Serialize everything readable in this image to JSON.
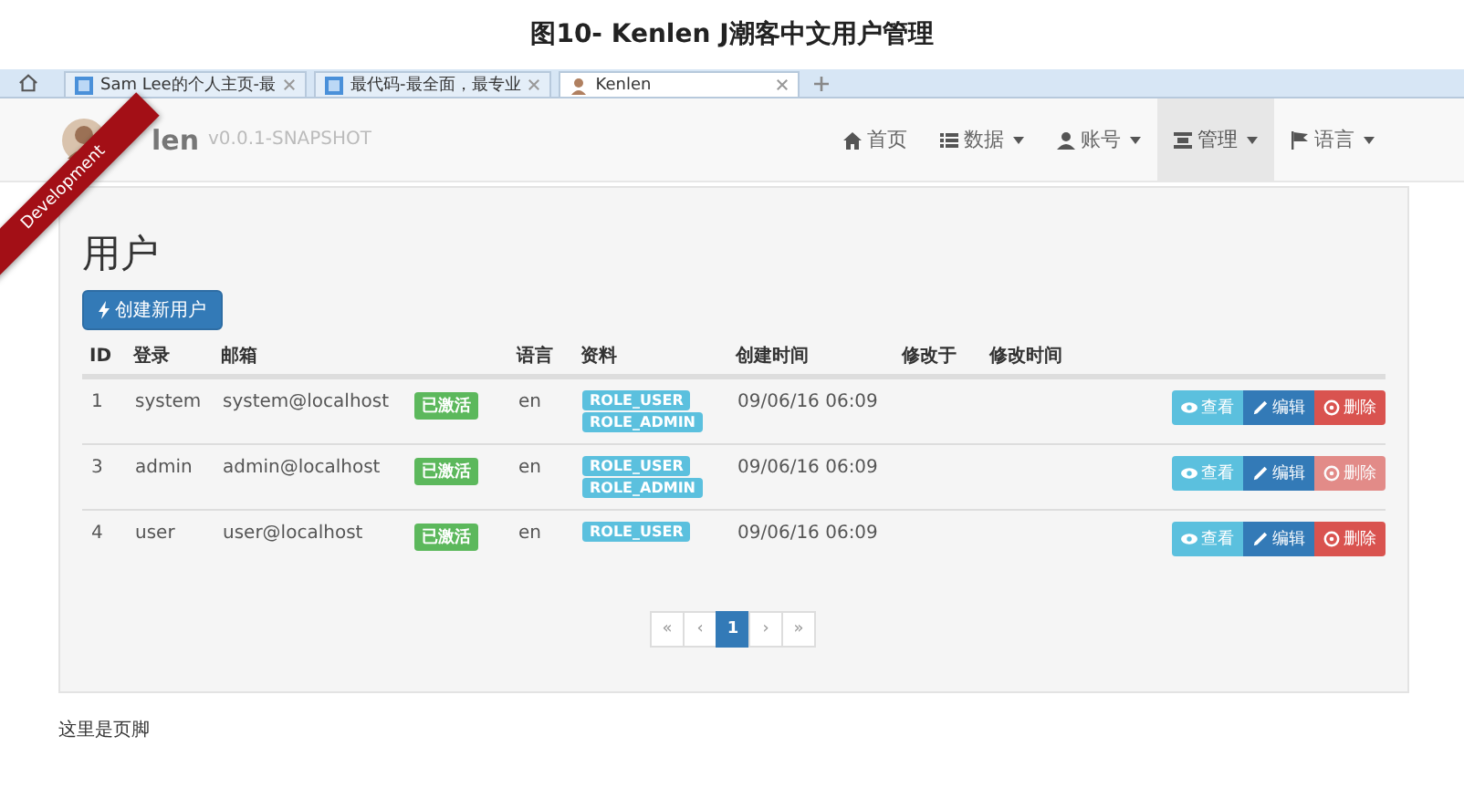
{
  "caption": "图10- Kenlen J潮客中文用户管理",
  "browser_tabs": [
    {
      "label": "Sam Lee的个人主页-最",
      "selected": false
    },
    {
      "label": "最代码-最全面，最专业",
      "selected": false
    },
    {
      "label": "Kenlen",
      "selected": true
    }
  ],
  "navbar": {
    "brand": "len",
    "version": "v0.0.1-SNAPSHOT",
    "ribbon": "Development",
    "items": [
      {
        "label": "首页",
        "dropdown": false,
        "selected": false
      },
      {
        "label": "数据",
        "dropdown": true,
        "selected": false
      },
      {
        "label": "账号",
        "dropdown": true,
        "selected": false
      },
      {
        "label": "管理",
        "dropdown": true,
        "selected": true
      },
      {
        "label": "语言",
        "dropdown": true,
        "selected": false
      }
    ]
  },
  "page": {
    "title": "用户",
    "create_button": "创建新用户",
    "table": {
      "columns": [
        "ID",
        "登录",
        "邮箱",
        "",
        "语言",
        "资料",
        "创建时间",
        "修改于",
        "修改时间"
      ],
      "rows": [
        {
          "id": "1",
          "login": "system",
          "email": "system@localhost",
          "status": "已激活",
          "lang": "en",
          "roles": [
            "ROLE_USER",
            "ROLE_ADMIN"
          ],
          "created": "09/06/16 06:09",
          "actions": [
            {
              "kind": "view",
              "label": "查看",
              "disabled": false
            },
            {
              "kind": "edit",
              "label": "编辑",
              "disabled": false
            },
            {
              "kind": "delete",
              "label": "删除",
              "disabled": false
            }
          ]
        },
        {
          "id": "3",
          "login": "admin",
          "email": "admin@localhost",
          "status": "已激活",
          "lang": "en",
          "roles": [
            "ROLE_USER",
            "ROLE_ADMIN"
          ],
          "created": "09/06/16 06:09",
          "actions": [
            {
              "kind": "view",
              "label": "查看",
              "disabled": false
            },
            {
              "kind": "edit",
              "label": "编辑",
              "disabled": false
            },
            {
              "kind": "delete",
              "label": "删除",
              "disabled": true
            }
          ]
        },
        {
          "id": "4",
          "login": "user",
          "email": "user@localhost",
          "status": "已激活",
          "lang": "en",
          "roles": [
            "ROLE_USER"
          ],
          "created": "09/06/16 06:09",
          "actions": [
            {
              "kind": "view",
              "label": "查看",
              "disabled": false
            },
            {
              "kind": "edit",
              "label": "编辑",
              "disabled": false
            },
            {
              "kind": "delete",
              "label": "删除",
              "disabled": false
            }
          ]
        }
      ]
    },
    "pagination": [
      {
        "label": "«",
        "selected": false
      },
      {
        "label": "‹",
        "selected": false
      },
      {
        "label": "1",
        "selected": true
      },
      {
        "label": "›",
        "selected": false
      },
      {
        "label": "»",
        "selected": false
      }
    ]
  },
  "footer": "这里是页脚"
}
